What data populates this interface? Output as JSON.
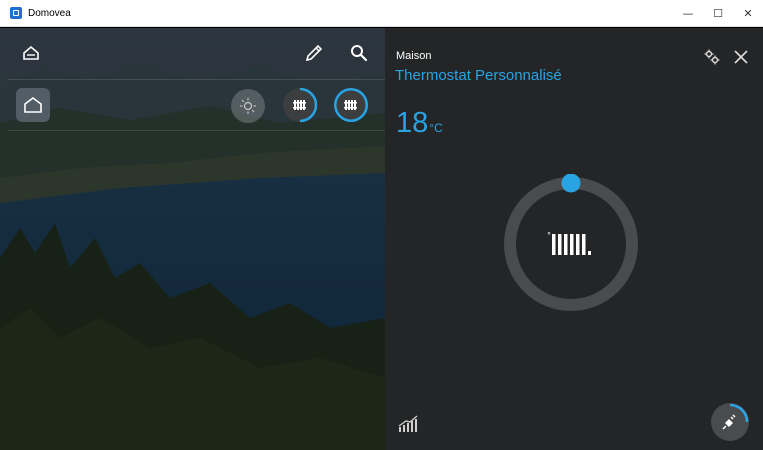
{
  "window": {
    "title": "Domovea",
    "minimize": "—",
    "maximize": "☐",
    "close": "✕"
  },
  "left_panel": {
    "icons": {
      "home_top": "home-outline-icon",
      "edit": "pencil-icon",
      "search": "search-icon",
      "home_tile": "home-icon",
      "scene_off": "sun-off-icon",
      "scene_partial": "radiator-icon",
      "scene_active": "radiator-icon"
    }
  },
  "right_panel": {
    "room": "Maison",
    "title": "Thermostat Personnalisé",
    "temperature": "18",
    "temperature_unit": "°C",
    "dial_progress": 0.0,
    "colors": {
      "accent": "#2aa3e3",
      "panel": "#242526",
      "ring": "#4a4b4c"
    },
    "icons": {
      "settings": "gears-icon",
      "close": "close-icon",
      "history": "graph-icon",
      "mode": "plug-icon",
      "radiator": "radiator-icon"
    }
  }
}
